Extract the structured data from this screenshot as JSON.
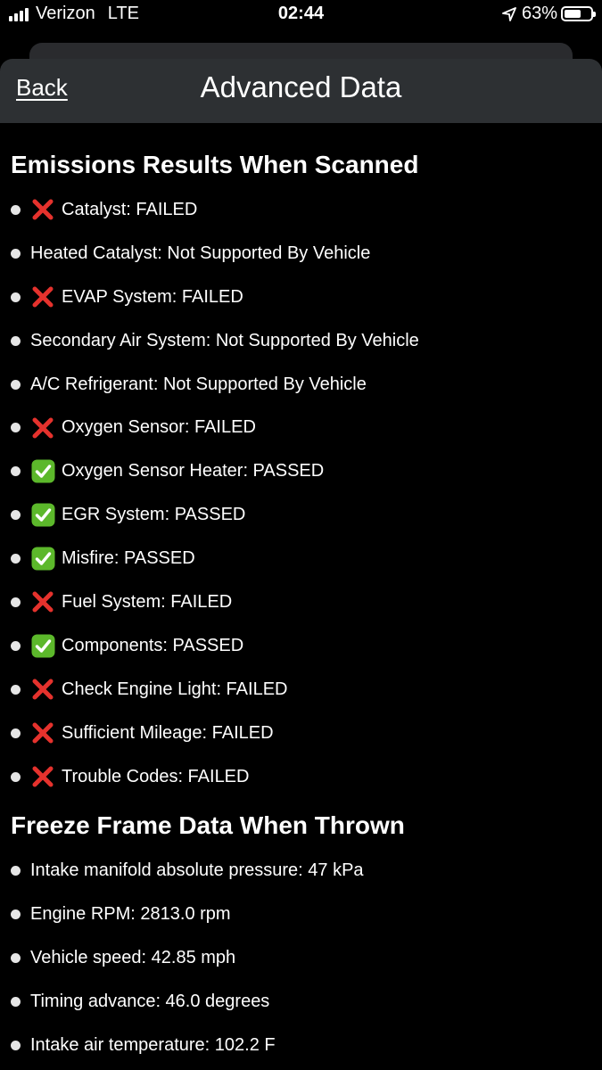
{
  "status_bar": {
    "carrier": "Verizon",
    "network": "LTE",
    "time": "02:44",
    "battery": "63%",
    "battery_level": 0.63
  },
  "nav": {
    "back_label": "Back",
    "title": "Advanced Data"
  },
  "emissions": {
    "title": "Emissions Results When Scanned",
    "items": [
      {
        "status": "failed",
        "icon": "cross-mark-icon",
        "text": "Catalyst: FAILED"
      },
      {
        "status": "none",
        "icon": "",
        "text": "Heated Catalyst: Not Supported By Vehicle"
      },
      {
        "status": "failed",
        "icon": "cross-mark-icon",
        "text": "EVAP System: FAILED"
      },
      {
        "status": "none",
        "icon": "",
        "text": "Secondary Air System: Not Supported By Vehicle"
      },
      {
        "status": "none",
        "icon": "",
        "text": "A/C Refrigerant: Not Supported By Vehicle"
      },
      {
        "status": "failed",
        "icon": "cross-mark-icon",
        "text": "Oxygen Sensor: FAILED"
      },
      {
        "status": "passed",
        "icon": "check-mark-icon",
        "text": "Oxygen Sensor Heater: PASSED"
      },
      {
        "status": "passed",
        "icon": "check-mark-icon",
        "text": "EGR System: PASSED"
      },
      {
        "status": "passed",
        "icon": "check-mark-icon",
        "text": "Misfire: PASSED"
      },
      {
        "status": "failed",
        "icon": "cross-mark-icon",
        "text": "Fuel System: FAILED"
      },
      {
        "status": "passed",
        "icon": "check-mark-icon",
        "text": "Components: PASSED"
      },
      {
        "status": "failed",
        "icon": "cross-mark-icon",
        "text": "Check Engine Light: FAILED"
      },
      {
        "status": "failed",
        "icon": "cross-mark-icon",
        "text": "Sufficient Mileage: FAILED"
      },
      {
        "status": "failed",
        "icon": "cross-mark-icon",
        "text": "Trouble Codes: FAILED"
      }
    ]
  },
  "freeze_frame": {
    "title": "Freeze Frame Data When Thrown",
    "items": [
      {
        "text": "Intake manifold absolute pressure: 47 kPa"
      },
      {
        "text": "Engine RPM: 2813.0 rpm"
      },
      {
        "text": "Vehicle speed: 42.85 mph"
      },
      {
        "text": "Timing advance: 46.0 degrees"
      },
      {
        "text": "Intake air temperature: 102.2 F"
      }
    ]
  },
  "colors": {
    "background": "#000000",
    "nav_bar": "#2d3033",
    "fail_red": "#e5322d",
    "pass_green": "#5cb82b"
  }
}
